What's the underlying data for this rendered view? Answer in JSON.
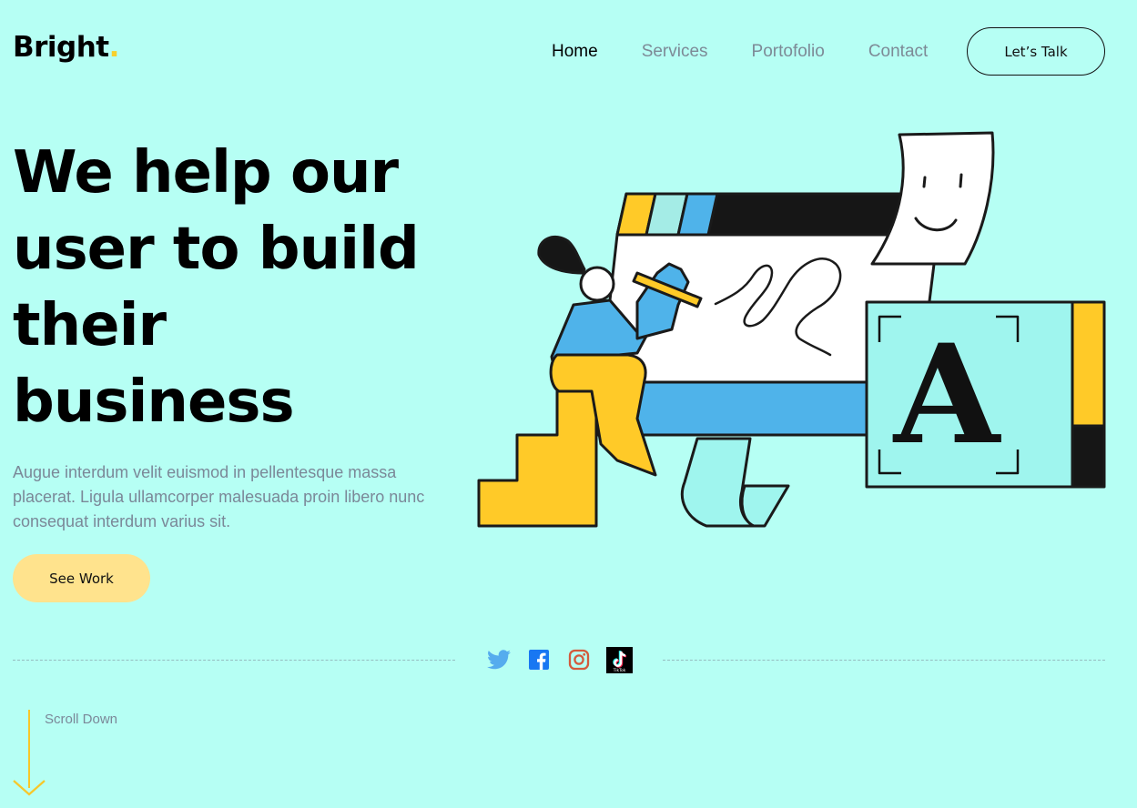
{
  "brand": {
    "name": "Bright",
    "dot": ".",
    "dot_color": "#f7d02c"
  },
  "nav": {
    "items": [
      {
        "label": "Home",
        "active": true
      },
      {
        "label": "Services",
        "active": false
      },
      {
        "label": "Portofolio",
        "active": false
      },
      {
        "label": "Contact",
        "active": false
      }
    ],
    "cta_label": "Let’s Talk"
  },
  "hero": {
    "headline": "We help our user to build their business",
    "description": "Augue interdum velit euismod in pellentesque massa placerat. Ligula ullamcorper malesuada proin libero nunc consequat interdum varius sit.",
    "button_label": "See Work",
    "illustration_letter": "A"
  },
  "social": [
    {
      "icon": "twitter-icon",
      "color": "#55acee"
    },
    {
      "icon": "facebook-icon",
      "color": "#1877f2"
    },
    {
      "icon": "instagram-icon",
      "color": "#d35a3c"
    },
    {
      "icon": "tiktok-icon",
      "color": "#000000",
      "label": "TikTok"
    }
  ],
  "scroll": {
    "label": "Scroll Down",
    "color": "#f7c72a"
  },
  "colors": {
    "background": "#b6fff4",
    "accent_yellow": "#ffca28",
    "button_yellow": "#ffe38d",
    "illustration_blue": "#4fb3ea",
    "muted_text": "#7b8898"
  }
}
